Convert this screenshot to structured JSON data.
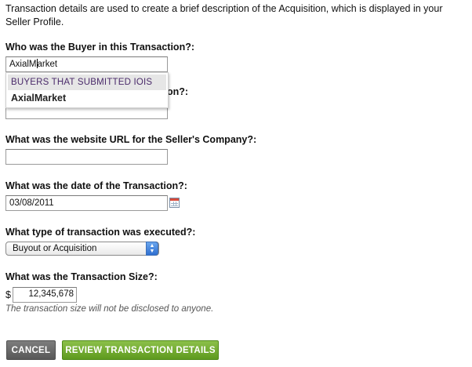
{
  "intro": "Transaction details are used to create a brief description of the Acquisition, which is displayed in your Seller Profile.",
  "buyer": {
    "label": "Who was the Buyer in this Transaction?:",
    "value_before_caret": "AxialM",
    "value_after_caret": "arket"
  },
  "buyer_dropdown": {
    "group_header": "BUYERS THAT SUBMITTED IOIS",
    "options": [
      "AxialMarket"
    ]
  },
  "hidden_question_tail": "on?:",
  "website": {
    "label": "What was the website URL for the Seller's Company?:",
    "value": ""
  },
  "date": {
    "label": "What was the date of the Transaction?:",
    "value": "03/08/2011",
    "icon": "calendar-icon"
  },
  "transaction_type": {
    "label": "What type of transaction was executed?:",
    "selected": "Buyout or Acquisition"
  },
  "size": {
    "label": "What was the Transaction Size?:",
    "currency": "$",
    "value": "12,345,678",
    "hint": "The transaction size will not be disclosed to anyone."
  },
  "buttons": {
    "cancel": "CANCEL",
    "review": "REVIEW TRANSACTION DETAILS"
  },
  "colors": {
    "review_button": "#6aa82c",
    "cancel_button": "#666666",
    "dropdown_header_text": "#4a2a6a"
  }
}
